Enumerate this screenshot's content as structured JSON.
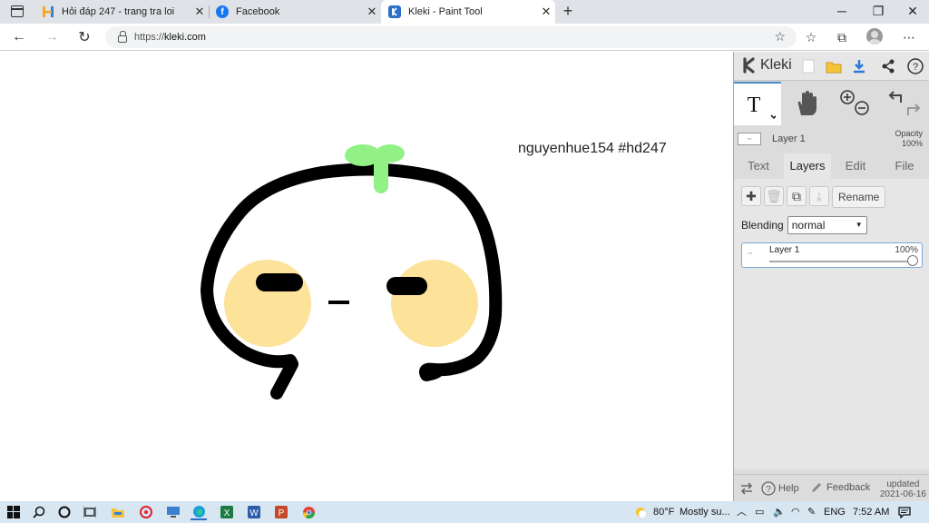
{
  "browser": {
    "tabs": [
      {
        "title": "Hỏi đáp 247 - trang tra loi",
        "favicon": "hoidap-logo"
      },
      {
        "title": "Facebook",
        "favicon": "facebook-logo"
      },
      {
        "title": "Kleki - Paint Tool",
        "favicon": "kleki-logo"
      }
    ],
    "url": "https://kleki.com",
    "url_prefix": "https://",
    "url_host": "kleki.com"
  },
  "canvas": {
    "signature": "nguyenhue154 #hd247",
    "colors": {
      "stroke": "#000000",
      "cheek": "#fde29a",
      "sprout": "#92f184"
    }
  },
  "kleki": {
    "logo_text": "Kleki",
    "layer_name": "Layer 1",
    "opacity_label": "Opacity",
    "opacity_value": "100%",
    "tabs": [
      "Text",
      "Layers",
      "Edit",
      "File"
    ],
    "active_tab": "Layers",
    "rename_label": "Rename",
    "blending_label": "Blending",
    "blending_value": "normal",
    "layer_item": {
      "name": "Layer 1",
      "opacity": "100%",
      "opacity_fraction": 1.0
    },
    "footer": {
      "help": "Help",
      "feedback": "Feedback",
      "updated_label": "updated",
      "updated_date": "2021-06-16"
    },
    "accent": "#4a89c8"
  },
  "taskbar": {
    "weather_temp": "80°F",
    "weather_desc": "Mostly su...",
    "lang": "ENG",
    "time": "7:52 AM"
  }
}
